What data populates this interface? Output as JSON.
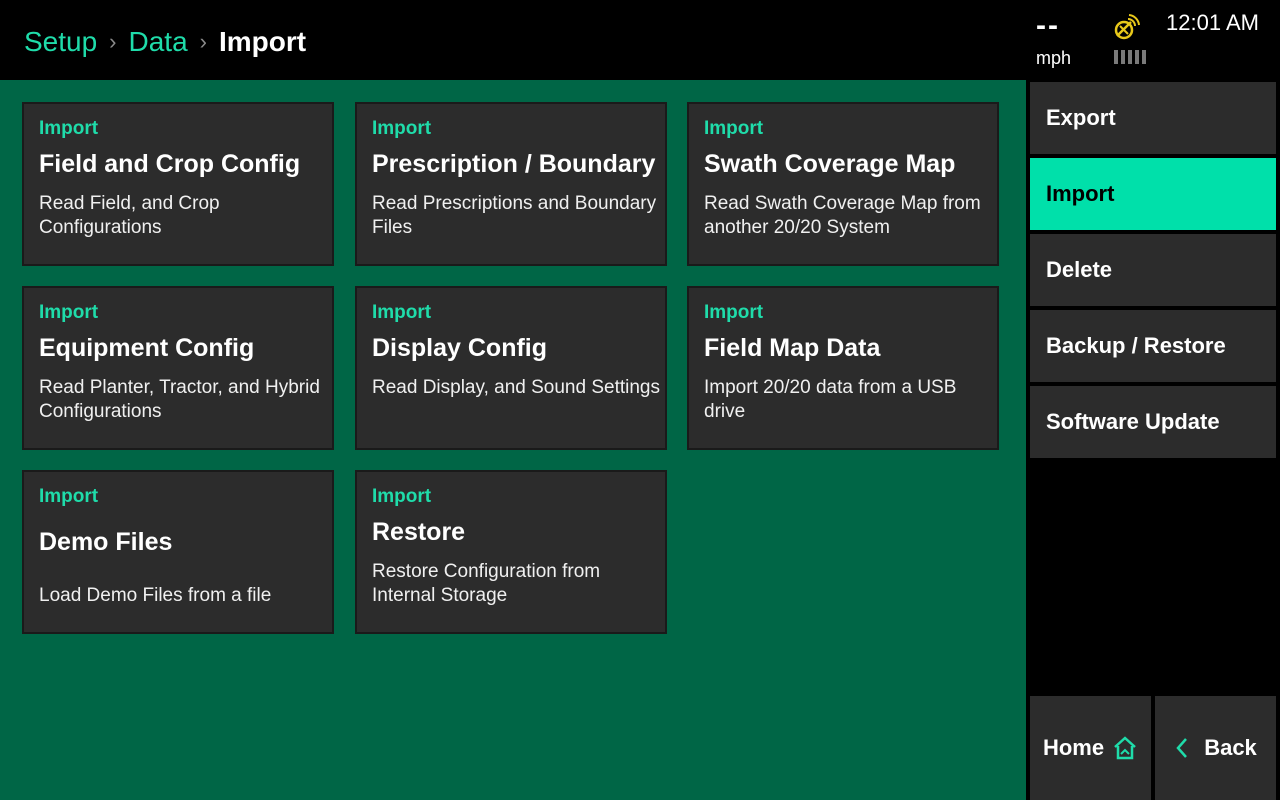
{
  "breadcrumb": {
    "items": [
      "Setup",
      "Data"
    ],
    "current": "Import",
    "separator": "›"
  },
  "status": {
    "speed_value": "--",
    "speed_unit": "mph",
    "gps_icon": "satellite-dish-icon",
    "time": "12:01 AM"
  },
  "cards": [
    {
      "tag": "Import",
      "title": "Field and Crop Config",
      "desc": "Read Field, and Crop Configurations"
    },
    {
      "tag": "Import",
      "title": "Prescription / Boundary",
      "desc": "Read Prescriptions and Boundary Files"
    },
    {
      "tag": "Import",
      "title": "Swath Coverage Map",
      "desc": "Read Swath Coverage Map from another 20/20 System"
    },
    {
      "tag": "Import",
      "title": "Equipment Config",
      "desc": "Read Planter, Tractor, and Hybrid Configurations"
    },
    {
      "tag": "Import",
      "title": "Display Config",
      "desc": "Read Display, and Sound Settings"
    },
    {
      "tag": "Import",
      "title": "Field Map Data",
      "desc": "Import 20/20 data from a USB drive"
    },
    {
      "tag": "Import",
      "title": "Demo Files",
      "desc": "Load Demo Files from a file"
    },
    {
      "tag": "Import",
      "title": "Restore",
      "desc": "Restore Configuration from Internal Storage"
    }
  ],
  "sidebar": {
    "items": [
      {
        "label": "Export"
      },
      {
        "label": "Import",
        "active": true
      },
      {
        "label": "Delete"
      },
      {
        "label": "Backup / Restore"
      },
      {
        "label": "Software Update"
      }
    ],
    "home_label": "Home",
    "back_label": "Back"
  },
  "colors": {
    "accent": "#1fdcaa",
    "active_bg": "#00e0aa",
    "main_bg": "#006646",
    "card_bg": "#2c2c2c",
    "gps_icon": "#e8c81a"
  }
}
